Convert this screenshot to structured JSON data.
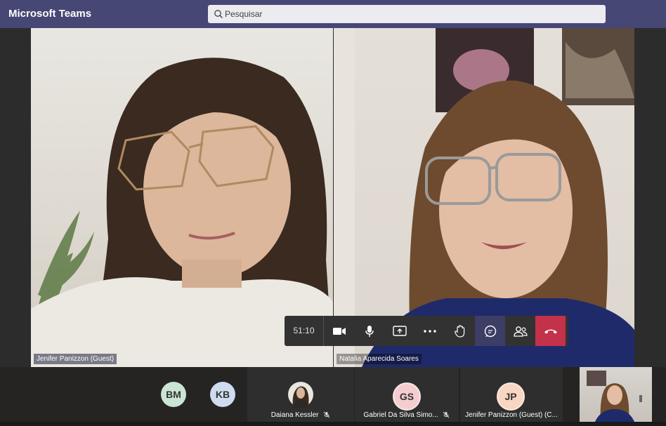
{
  "app": {
    "title": "Microsoft Teams"
  },
  "search": {
    "placeholder": "Pesquisar"
  },
  "tiles": [
    {
      "name": "Jenifer Panizzon (Guest)"
    },
    {
      "name": "Natalia Aparecida Soares"
    }
  ],
  "controls": {
    "timer": "51:10"
  },
  "participants": [
    {
      "initials": "BM",
      "name": ""
    },
    {
      "initials": "KB",
      "name": ""
    },
    {
      "initials": "",
      "name": "Daiana Kessler"
    },
    {
      "initials": "GS",
      "name": "Gabriel Da Silva Simo..."
    },
    {
      "initials": "JP",
      "name": "Jenifer Panizzon (Guest) (C..."
    }
  ],
  "colors": {
    "titlebar": "#464775",
    "hangup": "#c4314b",
    "accent": "#6264a7"
  }
}
